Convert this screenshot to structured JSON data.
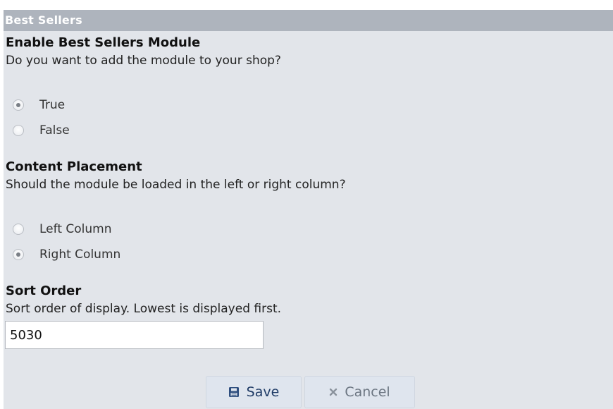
{
  "panel": {
    "title": "Best Sellers"
  },
  "sections": {
    "enable": {
      "title": "Enable Best Sellers Module",
      "description": "Do you want to add the module to your shop?",
      "options": [
        {
          "label": "True",
          "checked": true
        },
        {
          "label": "False",
          "checked": false
        }
      ]
    },
    "placement": {
      "title": "Content Placement",
      "description": "Should the module be loaded in the left or right column?",
      "options": [
        {
          "label": "Left Column",
          "checked": false
        },
        {
          "label": "Right Column",
          "checked": true
        }
      ]
    },
    "sort": {
      "title": "Sort Order",
      "description": "Sort order of display. Lowest is displayed first.",
      "value": "5030"
    }
  },
  "buttons": {
    "save_label": "Save",
    "save_icon": "save-icon",
    "cancel_label": "Cancel",
    "cancel_icon": "close-icon"
  },
  "colors": {
    "panel_bg": "#e2e5ea",
    "header_bg": "#aeb4bd",
    "save_text": "#1f3b66",
    "cancel_text": "#6c7682"
  }
}
